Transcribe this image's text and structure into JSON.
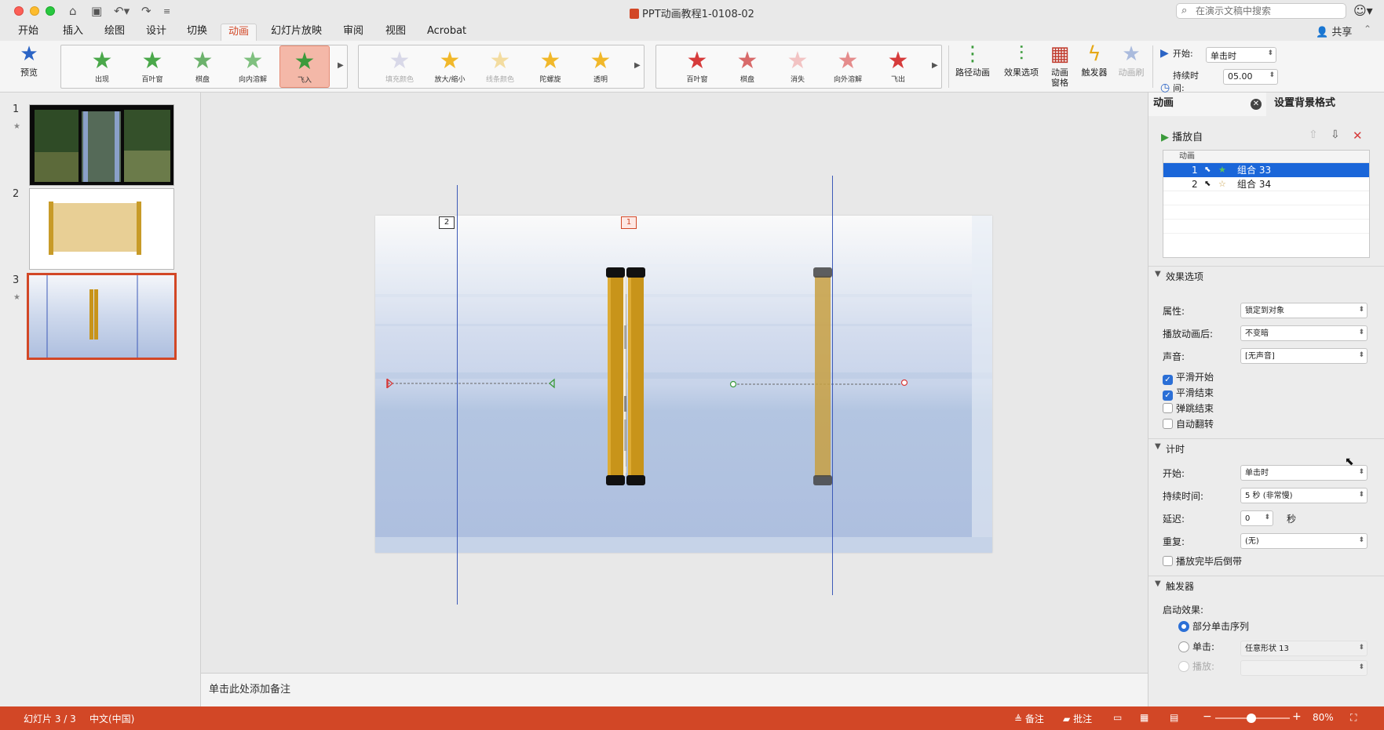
{
  "window": {
    "title": "PPT动画教程1-0108-02",
    "search_placeholder": "在演示文稿中搜索"
  },
  "tabs": [
    "开始",
    "插入",
    "绘图",
    "设计",
    "切换",
    "动画",
    "幻灯片放映",
    "审阅",
    "视图",
    "Acrobat"
  ],
  "active_tab": "动画",
  "share_label": "共享",
  "ribbon": {
    "preview_label": "预览",
    "entrance_effects": [
      "出现",
      "百叶窗",
      "棋盘",
      "向内溶解",
      "飞入"
    ],
    "selected_effect": "飞入",
    "emphasis_effects": [
      "填充颜色",
      "放大/缩小",
      "线条颜色",
      "陀螺旋",
      "透明"
    ],
    "exit_effects": [
      "百叶窗",
      "棋盘",
      "消失",
      "向外溶解",
      "飞出"
    ],
    "path_anim_label": "路径动画",
    "effect_options_label": "效果选项",
    "anim_pane_label": "动画\n窗格",
    "trigger_label": "触发器",
    "anim_painter_label": "动画刷",
    "start_label": "开始:",
    "start_value": "单击时",
    "duration_label": "持续时间:",
    "duration_value": "05.00"
  },
  "slides": [
    {
      "number": "1",
      "has_anim": true
    },
    {
      "number": "2",
      "has_anim": false
    },
    {
      "number": "3",
      "has_anim": true
    }
  ],
  "selected_slide": "3",
  "canvas": {
    "tag_1": "1",
    "tag_2": "2"
  },
  "notes_placeholder": "单击此处添加备注",
  "pane": {
    "tab_animation": "动画",
    "tab_background": "设置背景格式",
    "play_from_label": "播放自",
    "list_header": "动画",
    "items": [
      {
        "index": "1",
        "name": "组合 33",
        "selected": true
      },
      {
        "index": "2",
        "name": "组合 34",
        "selected": false
      }
    ],
    "effect_options": {
      "header": "效果选项",
      "property_label": "属性:",
      "property_value": "锁定到对象",
      "after_label": "播放动画后:",
      "after_value": "不变暗",
      "sound_label": "声音:",
      "sound_value": "[无声音]",
      "smooth_start": "平滑开始",
      "smooth_end": "平滑结束",
      "bounce_end": "弹跳结束",
      "auto_reverse": "自动翻转"
    },
    "timing": {
      "header": "计时",
      "start_label": "开始:",
      "start_value": "单击时",
      "duration_label": "持续时间:",
      "duration_value": "5 秒 (非常慢)",
      "delay_label": "延迟:",
      "delay_value": "0",
      "delay_unit": "秒",
      "repeat_label": "重复:",
      "repeat_value": "(无)",
      "rewind_label": "播放完毕后倒带"
    },
    "trigger": {
      "header": "触发器",
      "start_effect_label": "启动效果:",
      "opt_sequence": "部分单击序列",
      "opt_click": "单击:",
      "click_value": "任意形状 13",
      "opt_play": "播放:"
    }
  },
  "status": {
    "slide_counter": "幻灯片 3 / 3",
    "language": "中文(中国)",
    "notes_btn": "备注",
    "comments_btn": "批注",
    "zoom_percent": "80%"
  },
  "colors": {
    "accent": "#d24726",
    "selection_blue": "#1a66d9",
    "scroll_gold": "#c8941a"
  }
}
